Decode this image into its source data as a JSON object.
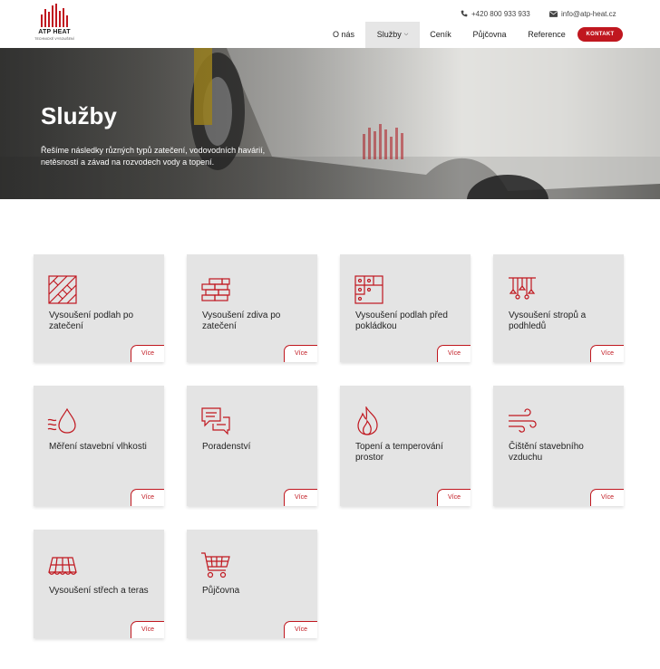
{
  "header": {
    "logo_name": "ATP HEAT",
    "logo_tagline": "TECHNICKÉ VYSOUŠENÍ",
    "phone": "+420 800 933 933",
    "email": "info@atp-heat.cz",
    "nav": [
      {
        "label": "O nás",
        "active": false
      },
      {
        "label": "Služby",
        "active": true
      },
      {
        "label": "Ceník",
        "active": false
      },
      {
        "label": "Půjčovna",
        "active": false
      },
      {
        "label": "Reference",
        "active": false
      }
    ],
    "contact_button": "KONTAKT"
  },
  "hero": {
    "title": "Služby",
    "text": "Řešíme následky různých typů zatečení, vodovodních havárií, netěsností a závad na rozvodech vody a topení."
  },
  "services": [
    {
      "title": "Vysoušení podlah po zatečení",
      "icon": "floor-tiles-icon",
      "button": "Více"
    },
    {
      "title": "Vysoušení zdiva po zatečení",
      "icon": "brick-wall-icon",
      "button": "Více"
    },
    {
      "title": "Vysoušení podlah před pokládkou",
      "icon": "floor-plan-icon",
      "button": "Více"
    },
    {
      "title": "Vysoušení stropů a podhledů",
      "icon": "ceiling-lights-icon",
      "button": "Více"
    },
    {
      "title": "Měření stavební vlhkosti",
      "icon": "water-drop-icon",
      "button": "Více"
    },
    {
      "title": "Poradenství",
      "icon": "chat-bubbles-icon",
      "button": "Více"
    },
    {
      "title": "Topení a temperování prostor",
      "icon": "flame-icon",
      "button": "Více"
    },
    {
      "title": "Čištění stavebního vzduchu",
      "icon": "wind-icon",
      "button": "Více"
    },
    {
      "title": "Vysoušení střech a teras",
      "icon": "roof-tiles-icon",
      "button": "Více"
    },
    {
      "title": "Půjčovna",
      "icon": "shopping-cart-icon",
      "button": "Více"
    }
  ],
  "colors": {
    "accent": "#c0171f",
    "card_bg": "#e4e4e4"
  }
}
